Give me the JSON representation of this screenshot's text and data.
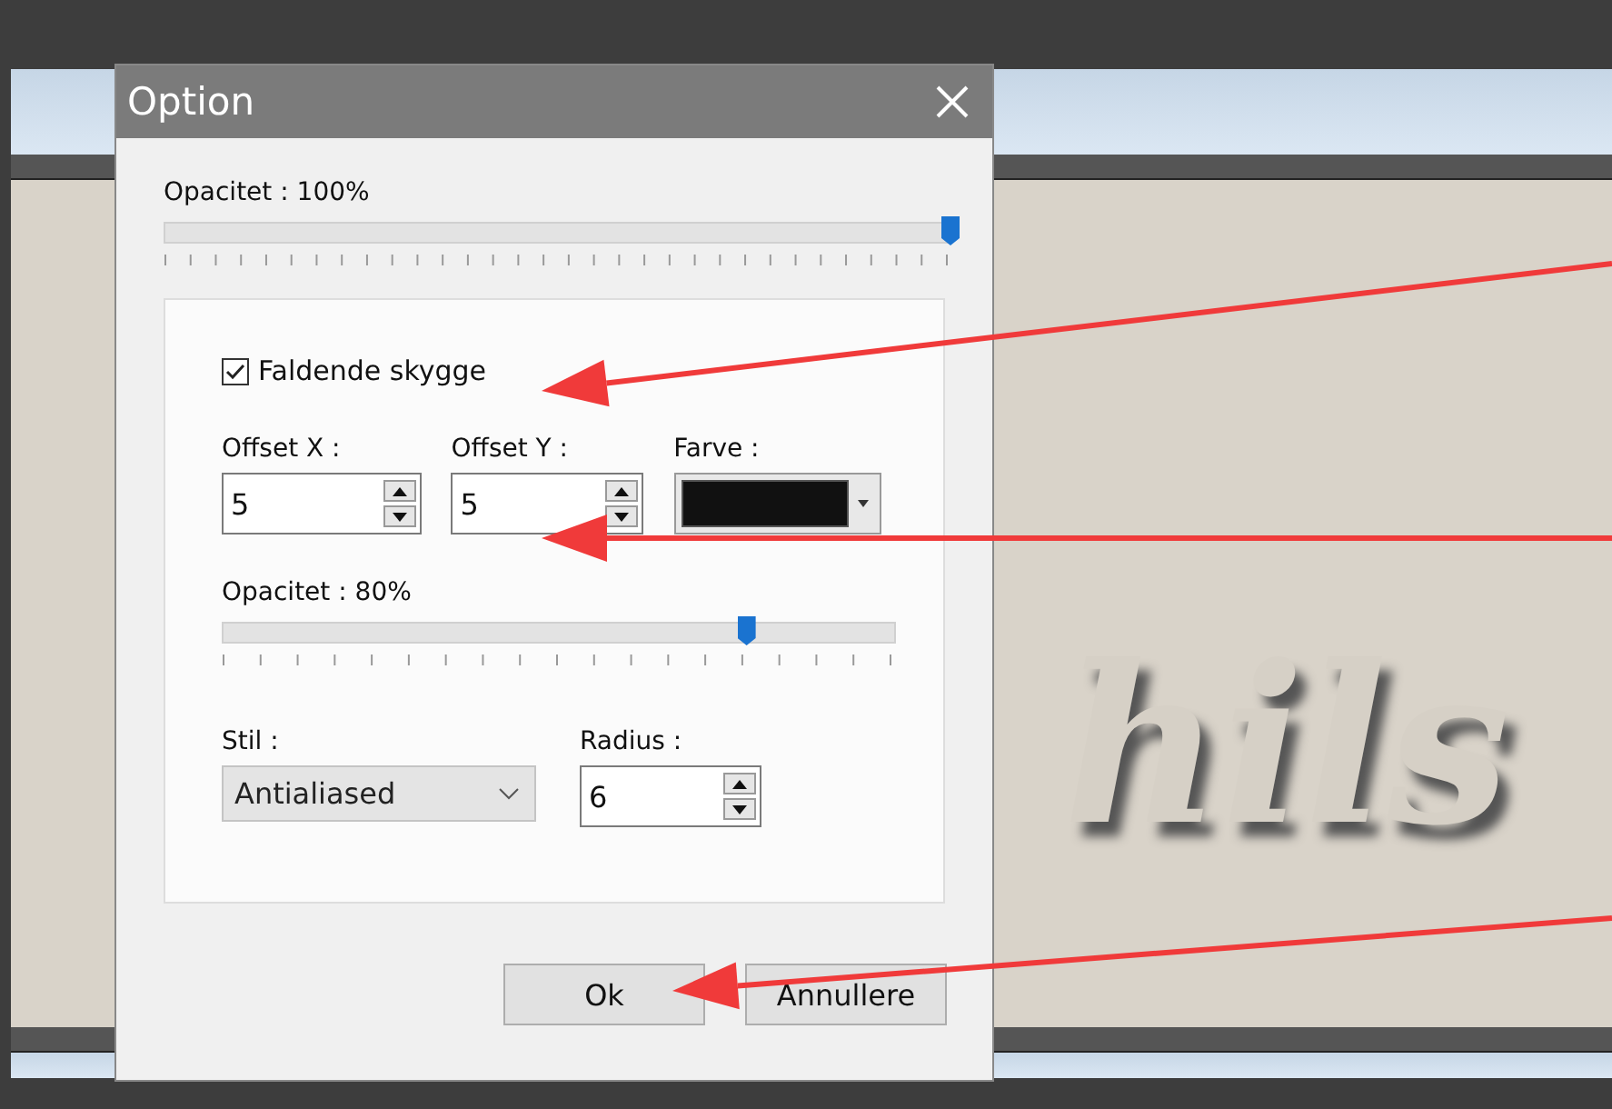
{
  "dialog": {
    "title": "Option",
    "opacity": {
      "label": "Opacitet : 100%",
      "level": 1.0
    },
    "shadow": {
      "label": "Faldende skygge",
      "checked": true,
      "offset_x": {
        "label": "Offset X :",
        "value": "5"
      },
      "offset_y": {
        "label": "Offset Y :",
        "value": "5"
      },
      "color": {
        "label": "Farve :",
        "color": "#111111"
      },
      "opacity": {
        "label": "Opacitet : 80%",
        "level": 0.78
      },
      "style": {
        "label": "Stil :",
        "value": "Antialiased"
      },
      "radius": {
        "label": "Radius :",
        "value": "6"
      }
    },
    "buttons": [
      {
        "label": "Ok"
      },
      {
        "label": "Annullere"
      }
    ]
  },
  "canvas": {
    "text": "hils"
  }
}
